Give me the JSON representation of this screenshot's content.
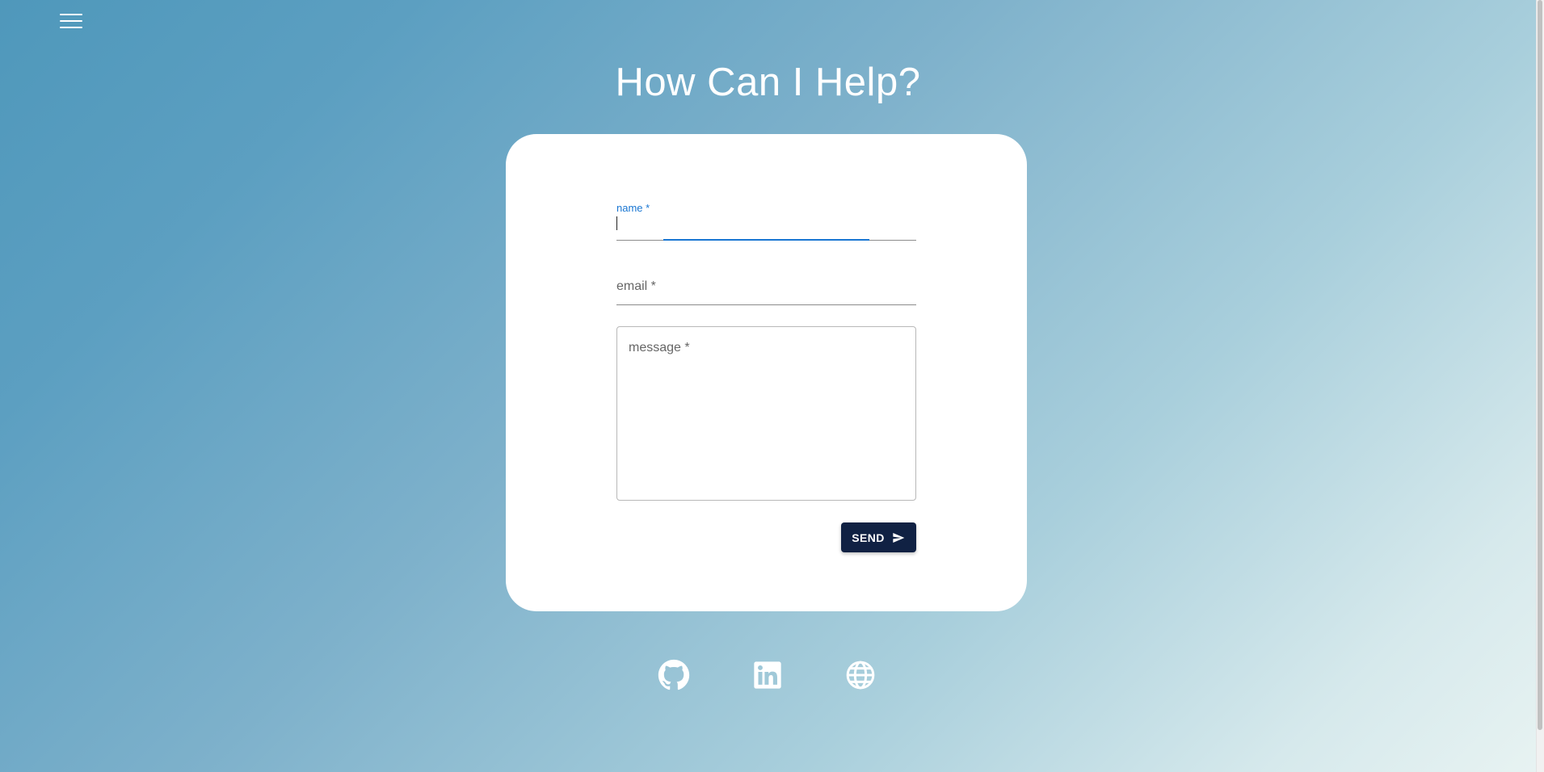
{
  "header": {
    "menu_icon": "hamburger-menu-icon",
    "title": "How Can I Help?"
  },
  "form": {
    "name": {
      "label": "name *",
      "value": ""
    },
    "email": {
      "label": "email *",
      "value": ""
    },
    "message": {
      "label": "message *",
      "value": ""
    },
    "send_label": "SEND",
    "send_icon": "send-icon"
  },
  "social_links": [
    {
      "icon": "github-icon"
    },
    {
      "icon": "linkedin-icon"
    },
    {
      "icon": "globe-icon"
    }
  ],
  "colors": {
    "primary": "#102143",
    "focus": "#1976d2",
    "background_start": "#4f98bb",
    "background_end": "#e8f3f2",
    "card": "#ffffff"
  }
}
